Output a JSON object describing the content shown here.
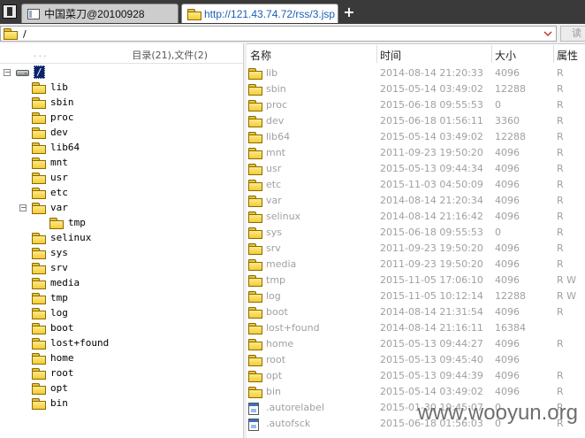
{
  "tabs": [
    {
      "title": "中国菜刀@20100928",
      "active": false
    },
    {
      "title": "http://121.43.74.72/rss/3.jsp",
      "active": true
    }
  ],
  "new_tab_label": "+",
  "address": {
    "path": "/",
    "read_button": "读"
  },
  "tree": {
    "header_dots": "...",
    "summary": "目录(21),文件(2)",
    "root_label": "/",
    "items": [
      {
        "label": "lib"
      },
      {
        "label": "sbin"
      },
      {
        "label": "proc"
      },
      {
        "label": "dev"
      },
      {
        "label": "lib64"
      },
      {
        "label": "mnt"
      },
      {
        "label": "usr"
      },
      {
        "label": "etc"
      },
      {
        "label": "var",
        "expanded": true
      },
      {
        "label": "tmp",
        "child": true
      },
      {
        "label": "selinux"
      },
      {
        "label": "sys"
      },
      {
        "label": "srv"
      },
      {
        "label": "media"
      },
      {
        "label": "tmp"
      },
      {
        "label": "log"
      },
      {
        "label": "boot"
      },
      {
        "label": "lost+found"
      },
      {
        "label": "home"
      },
      {
        "label": "root"
      },
      {
        "label": "opt"
      },
      {
        "label": "bin"
      }
    ]
  },
  "columns": {
    "name": "名称",
    "time": "时间",
    "size": "大小",
    "perm": "属性"
  },
  "files": [
    {
      "name": "lib",
      "time": "2014-08-14 21:20:33",
      "size": "4096",
      "perm": "R",
      "type": "folder"
    },
    {
      "name": "sbin",
      "time": "2015-05-14 03:49:02",
      "size": "12288",
      "perm": "R",
      "type": "folder"
    },
    {
      "name": "proc",
      "time": "2015-06-18 09:55:53",
      "size": "0",
      "perm": "R",
      "type": "folder"
    },
    {
      "name": "dev",
      "time": "2015-06-18 01:56:11",
      "size": "3360",
      "perm": "R",
      "type": "folder"
    },
    {
      "name": "lib64",
      "time": "2015-05-14 03:49:02",
      "size": "12288",
      "perm": "R",
      "type": "folder"
    },
    {
      "name": "mnt",
      "time": "2011-09-23 19:50:20",
      "size": "4096",
      "perm": "R",
      "type": "folder"
    },
    {
      "name": "usr",
      "time": "2015-05-13 09:44:34",
      "size": "4096",
      "perm": "R",
      "type": "folder"
    },
    {
      "name": "etc",
      "time": "2015-11-03 04:50:09",
      "size": "4096",
      "perm": "R",
      "type": "folder"
    },
    {
      "name": "var",
      "time": "2014-08-14 21:20:34",
      "size": "4096",
      "perm": "R",
      "type": "folder"
    },
    {
      "name": "selinux",
      "time": "2014-08-14 21:16:42",
      "size": "4096",
      "perm": "R",
      "type": "folder"
    },
    {
      "name": "sys",
      "time": "2015-06-18 09:55:53",
      "size": "0",
      "perm": "R",
      "type": "folder"
    },
    {
      "name": "srv",
      "time": "2011-09-23 19:50:20",
      "size": "4096",
      "perm": "R",
      "type": "folder"
    },
    {
      "name": "media",
      "time": "2011-09-23 19:50:20",
      "size": "4096",
      "perm": "R",
      "type": "folder"
    },
    {
      "name": "tmp",
      "time": "2015-11-05 17:06:10",
      "size": "4096",
      "perm": "R W",
      "type": "folder"
    },
    {
      "name": "log",
      "time": "2015-11-05 10:12:14",
      "size": "12288",
      "perm": "R W",
      "type": "folder"
    },
    {
      "name": "boot",
      "time": "2014-08-14 21:31:54",
      "size": "4096",
      "perm": "R",
      "type": "folder"
    },
    {
      "name": "lost+found",
      "time": "2014-08-14 21:16:11",
      "size": "16384",
      "perm": "",
      "type": "folder"
    },
    {
      "name": "home",
      "time": "2015-05-13 09:44:27",
      "size": "4096",
      "perm": "R",
      "type": "folder"
    },
    {
      "name": "root",
      "time": "2015-05-13 09:45:40",
      "size": "4096",
      "perm": "",
      "type": "folder"
    },
    {
      "name": "opt",
      "time": "2015-05-13 09:44:39",
      "size": "4096",
      "perm": "R",
      "type": "folder"
    },
    {
      "name": "bin",
      "time": "2015-05-14 03:49:02",
      "size": "4096",
      "perm": "R",
      "type": "folder"
    },
    {
      "name": ".autorelabel",
      "time": "2015-01-30 19:45:07",
      "size": "0",
      "perm": "R",
      "type": "file"
    },
    {
      "name": ".autofsck",
      "time": "2015-06-18 01:56:03",
      "size": "0",
      "perm": "R",
      "type": "file"
    }
  ],
  "watermark": "www.wooyun.org",
  "colors": {
    "tabbar_bg": "#3a3a3a",
    "active_tab_text": "#1d5fb4",
    "selection_bg": "#0a246a",
    "folder_yellow": "#f4cc35",
    "list_text": "#a0a0a0"
  }
}
